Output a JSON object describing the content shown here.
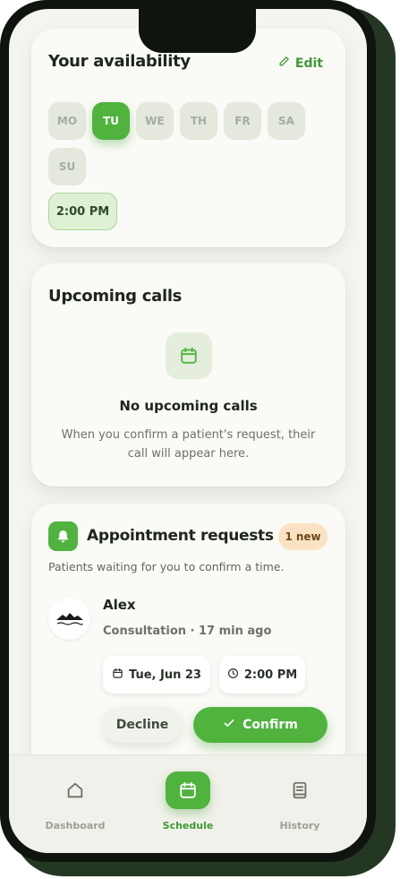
{
  "availability": {
    "title": "Your availability",
    "edit_label": "Edit",
    "days": [
      {
        "label": "MO",
        "selected": false
      },
      {
        "label": "TU",
        "selected": true
      },
      {
        "label": "WE",
        "selected": false
      },
      {
        "label": "TH",
        "selected": false
      },
      {
        "label": "FR",
        "selected": false
      },
      {
        "label": "SA",
        "selected": false
      },
      {
        "label": "SU",
        "selected": false
      }
    ],
    "time_slot": "2:00 PM"
  },
  "upcoming": {
    "title": "Upcoming calls",
    "empty_title": "No upcoming calls",
    "empty_text": "When you confirm a patient's request, their call will appear here.",
    "icon": "calendar-icon"
  },
  "requests": {
    "title": "Appointment requests",
    "badge": "1 new",
    "subtitle": "Patients waiting for you to confirm a time.",
    "items": [
      {
        "name": "Alex",
        "meta": "Consultation · 17 min ago",
        "date": "Tue, Jun 23",
        "time": "2:00 PM",
        "decline_label": "Decline",
        "confirm_label": "Confirm"
      }
    ]
  },
  "nav": {
    "items": [
      {
        "label": "Dashboard",
        "icon": "home-icon",
        "active": false
      },
      {
        "label": "Schedule",
        "icon": "calendar-icon",
        "active": true
      },
      {
        "label": "History",
        "icon": "book-icon",
        "active": false
      }
    ]
  },
  "colors": {
    "accent": "#4fb33e",
    "background": "#f4f5f0",
    "card": "#fafaf6",
    "badge_bg": "#fae3c2"
  }
}
